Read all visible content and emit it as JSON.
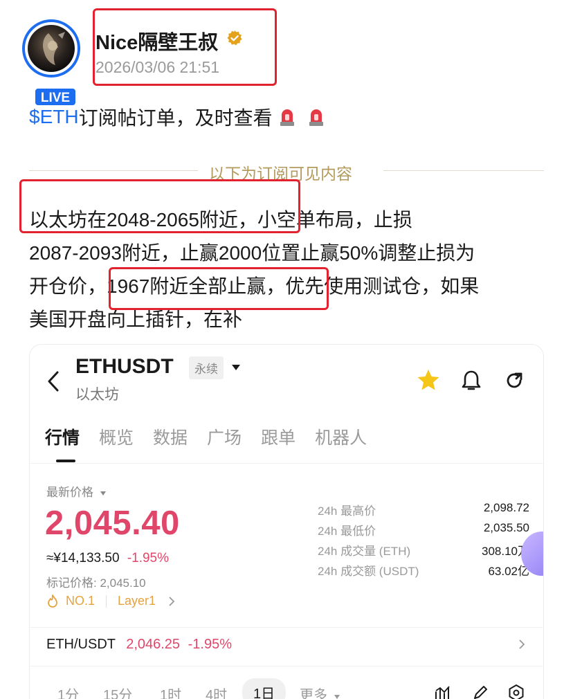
{
  "post": {
    "avatar_badge": "LIVE",
    "author": "Nice隔壁王叔",
    "timestamp": "2026/03/06 21:51",
    "title_ticker": "$ETH",
    "title_text": "订阅帖订单，及时查看",
    "divider_text": "以下为订阅可见内容",
    "body_lines": [
      "以太坊在2048-2065附近，小空单布局，止损",
      "2087-2093附近，止赢2000位置止赢50%调整止损为",
      "开仓价，1967附近全部止赢，优先使用测试仓，如果",
      "美国开盘向上插针，在补"
    ]
  },
  "card": {
    "symbol": "ETHUSDT",
    "perp_tag": "永续",
    "subtitle": "以太坊",
    "tabs": [
      {
        "label": "行情"
      },
      {
        "label": "概览"
      },
      {
        "label": "数据"
      },
      {
        "label": "广场"
      },
      {
        "label": "跟单"
      },
      {
        "label": "机器人"
      }
    ],
    "latest_price_label": "最新价格",
    "last_price": "2,045.40",
    "cny_price": "≈¥14,133.50",
    "change_pct": "-1.95%",
    "mark_price": "标记价格: 2,045.10",
    "rank_tag": "NO.1",
    "category_tag": "Layer1",
    "stats": [
      {
        "label": "24h 最高价",
        "value": "2,098.72"
      },
      {
        "label": "24h 最低价",
        "value": "2,035.50"
      },
      {
        "label": "24h 成交量 (ETH)",
        "value": "308.10万"
      },
      {
        "label": "24h 成交额 (USDT)",
        "value": "63.02亿"
      }
    ],
    "spot_pair": "ETH/USDT",
    "spot_price": "2,046.25",
    "spot_change": "-1.95%",
    "intervals": [
      {
        "label": "1分"
      },
      {
        "label": "15分"
      },
      {
        "label": "1时"
      },
      {
        "label": "4时"
      },
      {
        "label": "1日"
      },
      {
        "label": "更多"
      }
    ],
    "icons": [
      "back-icon",
      "star-icon",
      "bell-icon",
      "share-icon",
      "indicator-icon",
      "draw-icon",
      "settings-icon"
    ]
  },
  "colors": {
    "accent_blue": "#1d6df0",
    "annotation_red": "#e2222e",
    "price_red": "#e0466a",
    "divider_gold": "#b39a5e",
    "star_yellow": "#f5c518"
  }
}
